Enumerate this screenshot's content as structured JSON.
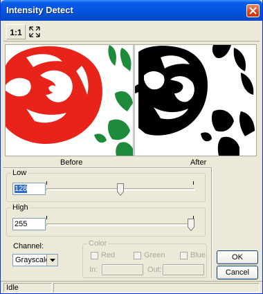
{
  "window": {
    "title": "Intensity Detect"
  },
  "toolbar": {
    "actual_size_label": "1:1",
    "fit_icon": "fit-window-icon"
  },
  "preview": {
    "before_caption": "Before",
    "after_caption": "After"
  },
  "low": {
    "label": "Low",
    "value": "128",
    "slider_value": 128,
    "slider_max": 255
  },
  "high": {
    "label": "High",
    "value": "255",
    "slider_value": 255,
    "slider_max": 255
  },
  "channel": {
    "label": "Channel:",
    "selected": "Grayscale"
  },
  "color": {
    "label": "Color",
    "red": "Red",
    "green": "Green",
    "blue": "Blue",
    "in_label": "In:",
    "out_label": "Out:"
  },
  "buttons": {
    "ok": "OK",
    "cancel": "Cancel"
  },
  "status": {
    "text": "Idle"
  },
  "colors": {
    "title_bar": "#0554e3",
    "rose_red": "#e8231a",
    "leaf_green": "#1e8a3c"
  }
}
